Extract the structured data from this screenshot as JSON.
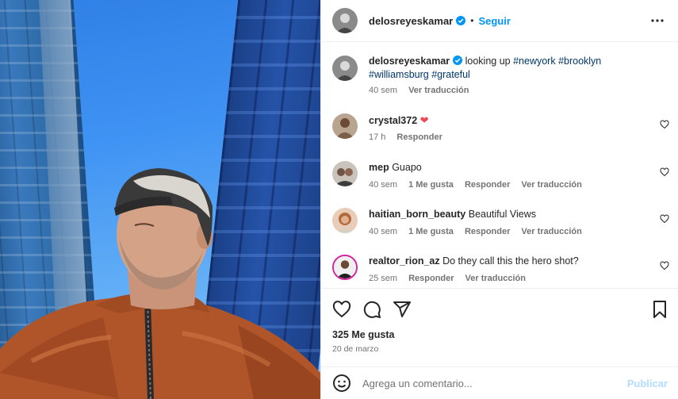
{
  "post": {
    "author": "delosreyeskamar",
    "follow_label": "Seguir",
    "separator": "•",
    "caption_text": " looking up ",
    "hashtags_line1": "#newyork #brooklyn",
    "hashtags_line2": "#williamsburg #grateful",
    "caption_time": "40 sem",
    "caption_translate": "Ver traducción"
  },
  "comments": [
    {
      "user": "crystal372",
      "text": "",
      "emoji": "❤",
      "time": "17 h",
      "likes": "",
      "reply": "Responder",
      "translate": ""
    },
    {
      "user": "mep",
      "text": "Guapo",
      "time": "40 sem",
      "likes": "1 Me gusta",
      "reply": "Responder",
      "translate": "Ver traducción"
    },
    {
      "user": "haitian_born_beauty",
      "text": "Beautiful Views",
      "time": "40 sem",
      "likes": "1 Me gusta",
      "reply": "Responder",
      "translate": "Ver traducción"
    },
    {
      "user": "realtor_rion_az",
      "text": "Do they call this the hero shot?",
      "time": "25 sem",
      "likes": "",
      "reply": "Responder",
      "translate": "Ver traducción"
    }
  ],
  "stats": {
    "likes": "325 Me gusta",
    "date": "20 de marzo"
  },
  "composer": {
    "placeholder": "Agrega un comentario...",
    "publish_label": "Publicar"
  },
  "icons": {
    "verified": "verified-badge-icon",
    "more": "more-options-icon",
    "like": "heart-icon",
    "comment": "comment-icon",
    "share": "share-icon",
    "save": "bookmark-icon",
    "emoji": "emoji-icon"
  },
  "colors": {
    "accent": "#0095f6",
    "verified": "#0095f6",
    "hashtag": "#00376b",
    "heart": "#ed4956",
    "muted": "#737373"
  }
}
